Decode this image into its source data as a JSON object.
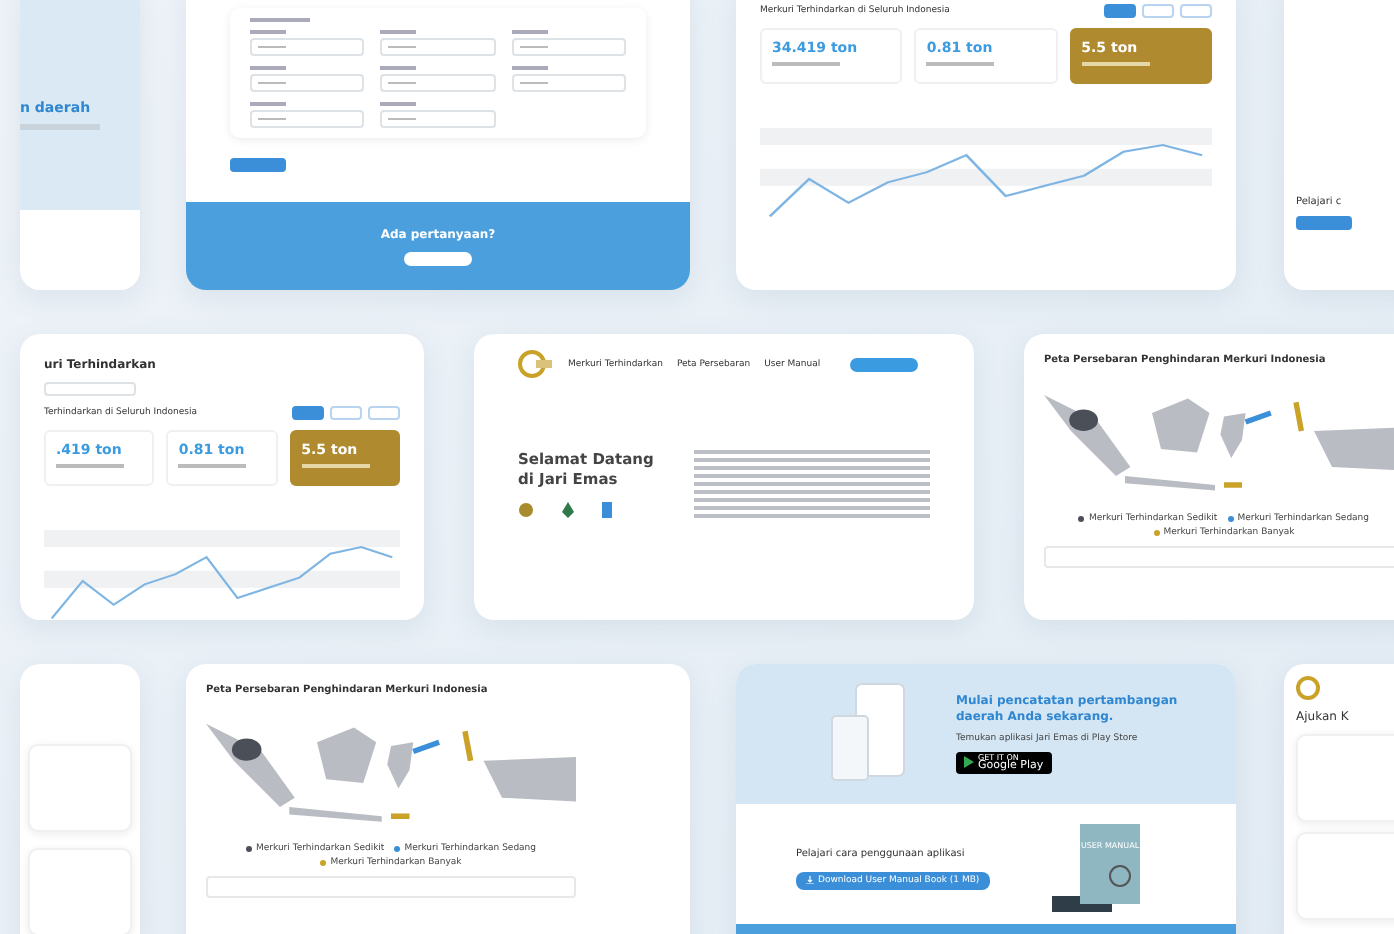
{
  "showcase": {
    "cards": [
      {
        "kind": "hero_cut",
        "title": "n daerah"
      },
      {
        "kind": "form_footer",
        "footer_title": "Ada pertanyaan?"
      },
      {
        "kind": "stats",
        "heading": "Merkuri Terhindarkan di Seluruh Indonesia",
        "filters": [
          {
            "selected": true
          },
          {
            "selected": false
          },
          {
            "selected": false
          }
        ],
        "stats": [
          {
            "value": "34.419 ton",
            "highlighted": false
          },
          {
            "value": "0.81 ton",
            "highlighted": false
          },
          {
            "value": "5.5 ton",
            "highlighted": true
          }
        ]
      },
      {
        "kind": "learn_cut",
        "title": "Pelajari c"
      },
      {
        "kind": "stats",
        "page_title": "uri Terhindarkan",
        "heading": "Terhindarkan di Seluruh Indonesia",
        "filters": [
          {
            "selected": true
          },
          {
            "selected": false
          },
          {
            "selected": false
          }
        ],
        "stats": [
          {
            "value": ".419 ton",
            "highlighted": false
          },
          {
            "value": "0.81 ton",
            "highlighted": false
          },
          {
            "value": "5.5 ton",
            "highlighted": true
          }
        ]
      },
      {
        "kind": "home",
        "nav": [
          "Merkuri Terhindarkan",
          "Peta Persebaran",
          "User Manual"
        ],
        "title": "Selamat Datang di Jari Emas"
      },
      {
        "kind": "map",
        "title": "Peta Persebaran Penghindaran Merkuri Indonesia",
        "legend": [
          {
            "label": "Merkuri Terhindarkan Sedikit",
            "color": "#4b5058"
          },
          {
            "label": "Merkuri Terhindarkan Sedang",
            "color": "#3b8fd9"
          },
          {
            "label": "Merkuri Terhindarkan Banyak",
            "color": "#c9a227"
          }
        ]
      },
      {
        "kind": "plain"
      },
      {
        "kind": "map",
        "title": "Peta Persebaran Penghindaran Merkuri Indonesia",
        "legend": [
          {
            "label": "Merkuri Terhindarkan Sedikit",
            "color": "#4b5058"
          },
          {
            "label": "Merkuri Terhindarkan Sedang",
            "color": "#3b8fd9"
          },
          {
            "label": "Merkuri Terhindarkan Banyak",
            "color": "#c9a227"
          }
        ]
      },
      {
        "kind": "app_promo",
        "title": "Mulai pencatatan pertambangan daerah Anda sekarang.",
        "subtitle": "Temukan aplikasi Jari Emas di Play Store",
        "badge_small": "GET IT ON",
        "badge_big": "Google Play",
        "learn_title": "Pelajari cara penggunaan aplikasi",
        "download_button": "Download User Manual Book (1 MB)",
        "book_label": "USER MANUAL"
      },
      {
        "kind": "form_cut",
        "title": "Ajukan K"
      }
    ]
  }
}
